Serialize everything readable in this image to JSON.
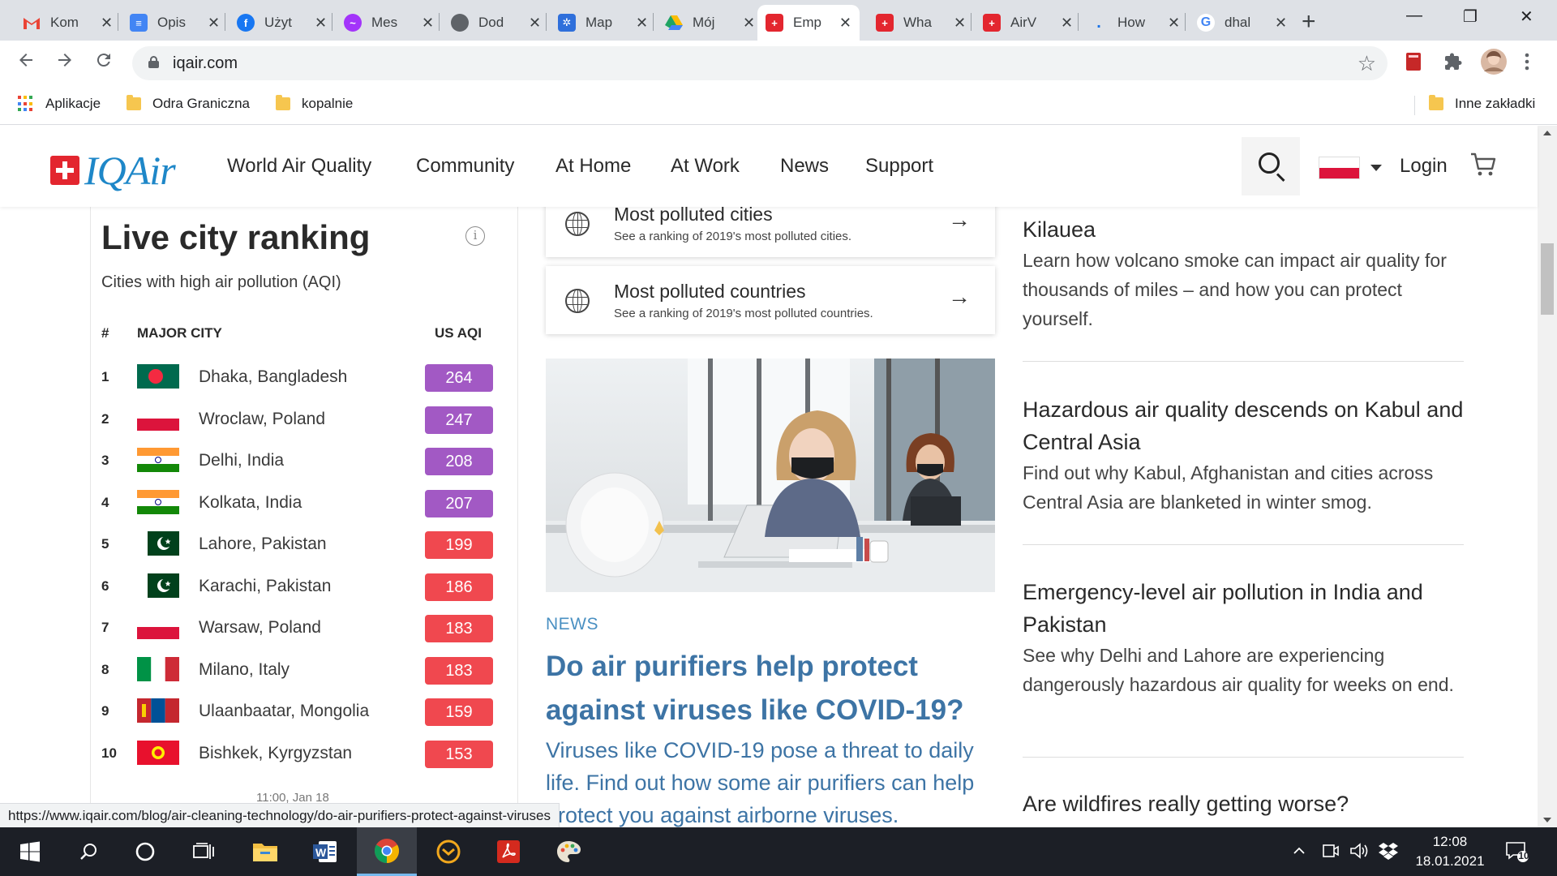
{
  "browser": {
    "tabs": [
      {
        "title": "Kom",
        "favicon": "gmail-icon",
        "color": "#ea4335"
      },
      {
        "title": "Opis",
        "favicon": "docs-icon",
        "color": "#4285f4"
      },
      {
        "title": "Użyt",
        "favicon": "facebook-icon",
        "color": "#1877f2"
      },
      {
        "title": "Mes",
        "favicon": "messenger-icon",
        "color": "#a334fa"
      },
      {
        "title": "Dod",
        "favicon": "site-icon",
        "color": "#5f6368"
      },
      {
        "title": "Map",
        "favicon": "eu-icon",
        "color": "#2f6fdb"
      },
      {
        "title": "Mój",
        "favicon": "drive-icon",
        "color": "#1fa463"
      },
      {
        "title": "Emp",
        "favicon": "iqair-icon",
        "color": "#e3262f",
        "active": true
      },
      {
        "title": "Wha",
        "favicon": "iqair-icon",
        "color": "#e3262f"
      },
      {
        "title": "AirV",
        "favicon": "iqair-icon",
        "color": "#e3262f"
      },
      {
        "title": "How",
        "favicon": "loading-icon",
        "color": "#1a73e8"
      },
      {
        "title": "dhal",
        "favicon": "google-icon",
        "color": "#4285f4"
      }
    ],
    "tab_close": "✕",
    "new_tab": "+",
    "window_controls": {
      "minimize": "—",
      "maximize": "❐",
      "close": "✕"
    },
    "url": "iqair.com",
    "bookmarks": {
      "apps": "Aplikacje",
      "folder1": "Odra Graniczna",
      "folder2": "kopalnie",
      "other": "Inne zakładki"
    },
    "status_url": "https://www.iqair.com/blog/air-cleaning-technology/do-air-purifiers-protect-against-viruses"
  },
  "site": {
    "brand": "IQAir",
    "nav": [
      "World Air Quality",
      "Community",
      "At Home",
      "At Work",
      "News",
      "Support"
    ],
    "login": "Login",
    "language_flag": "poland-flag"
  },
  "ranking": {
    "title": "Live city ranking",
    "subtitle": "Cities with high air pollution (AQI)",
    "info_icon": "i",
    "col_num": "#",
    "col_city": "MAJOR CITY",
    "col_aqi": "US AQI",
    "rows": [
      {
        "rank": "1",
        "city": "Dhaka, Bangladesh",
        "aqi": "264",
        "flag": "bangladesh"
      },
      {
        "rank": "2",
        "city": "Wroclaw, Poland",
        "aqi": "247",
        "flag": "poland"
      },
      {
        "rank": "3",
        "city": "Delhi, India",
        "aqi": "208",
        "flag": "india"
      },
      {
        "rank": "4",
        "city": "Kolkata, India",
        "aqi": "207",
        "flag": "india"
      },
      {
        "rank": "5",
        "city": "Lahore, Pakistan",
        "aqi": "199",
        "flag": "pakistan"
      },
      {
        "rank": "6",
        "city": "Karachi, Pakistan",
        "aqi": "186",
        "flag": "pakistan"
      },
      {
        "rank": "7",
        "city": "Warsaw, Poland",
        "aqi": "183",
        "flag": "poland"
      },
      {
        "rank": "8",
        "city": "Milano, Italy",
        "aqi": "183",
        "flag": "italy"
      },
      {
        "rank": "9",
        "city": "Ulaanbaatar, Mongolia",
        "aqi": "159",
        "flag": "mongolia"
      },
      {
        "rank": "10",
        "city": "Bishkek, Kyrgyzstan",
        "aqi": "153",
        "flag": "kyrgyzstan"
      }
    ],
    "aqi_colors": {
      "very_unhealthy": "#a259c4",
      "unhealthy": "#f0484f"
    },
    "timestamp": "11:00, Jan 18"
  },
  "middle": {
    "card1_title": "Most polluted cities",
    "card1_sub": "See a ranking of 2019's most polluted cities.",
    "card2_title": "Most polluted countries",
    "card2_sub": "See a ranking of 2019's most polluted countries.",
    "arrow": "→",
    "news_tag": "NEWS",
    "news_title": "Do air purifiers help protect against viruses like COVID-19?",
    "news_body": "Viruses like COVID-19 pose a threat to daily life. Find out how some air purifiers can help protect you against airborne viruses."
  },
  "right": {
    "articles": [
      {
        "title": "Kilauea",
        "body": "Learn how volcano smoke can impact air quality for thousands of miles – and how you can protect yourself."
      },
      {
        "title": "Hazardous air quality descends on Kabul and Central Asia",
        "body": "Find out why Kabul, Afghanistan and cities across Central Asia are blanketed in winter smog."
      },
      {
        "title": "Emergency-level air pollution in India and Pakistan",
        "body": "See why Delhi and Lahore are experiencing dangerously hazardous air quality for weeks on end."
      },
      {
        "title": "Are wildfires really getting worse?",
        "body": ""
      }
    ]
  },
  "taskbar": {
    "time": "12:08",
    "date": "18.01.2021",
    "notifications": "10",
    "apps": [
      "start-icon",
      "search-icon",
      "cortana-icon",
      "task-view-icon",
      "file-explorer-icon",
      "word-icon",
      "chrome-icon",
      "mailbird-icon",
      "acrobat-icon",
      "paint-icon"
    ]
  }
}
